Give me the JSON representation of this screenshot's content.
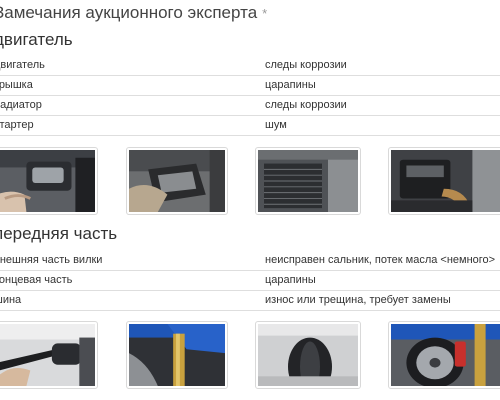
{
  "page": {
    "title": "Замечания аукционного эксперта",
    "title_marker": "*"
  },
  "sections": [
    {
      "title": "двигатель",
      "rows": [
        {
          "part": "двигатель",
          "remark": "следы коррозии"
        },
        {
          "part": "крышка",
          "remark": "царапины"
        },
        {
          "part": "радиатор",
          "remark": "следы коррозии"
        },
        {
          "part": "стартер",
          "remark": "шум"
        }
      ],
      "photos": [
        {
          "icon": "photo-engine-left-side"
        },
        {
          "icon": "photo-engine-underside"
        },
        {
          "icon": "photo-radiator"
        },
        {
          "icon": "photo-engine-right-side"
        }
      ]
    },
    {
      "title": "передняя часть",
      "rows": [
        {
          "part": "внешняя часть вилки",
          "remark": "неисправен сальник, потек масла <немного>"
        },
        {
          "part": "концевая часть",
          "remark": "царапины"
        },
        {
          "part": "шина",
          "remark": "износ или трещина, требует замены"
        }
      ],
      "photos": [
        {
          "icon": "photo-handlebar"
        },
        {
          "icon": "photo-front-fork"
        },
        {
          "icon": "photo-front-tire"
        },
        {
          "icon": "photo-front-wheel-brake"
        }
      ]
    }
  ],
  "colors": {
    "text": "#333333",
    "divider": "#dedede",
    "thumb_border": "#d9d9d9"
  }
}
